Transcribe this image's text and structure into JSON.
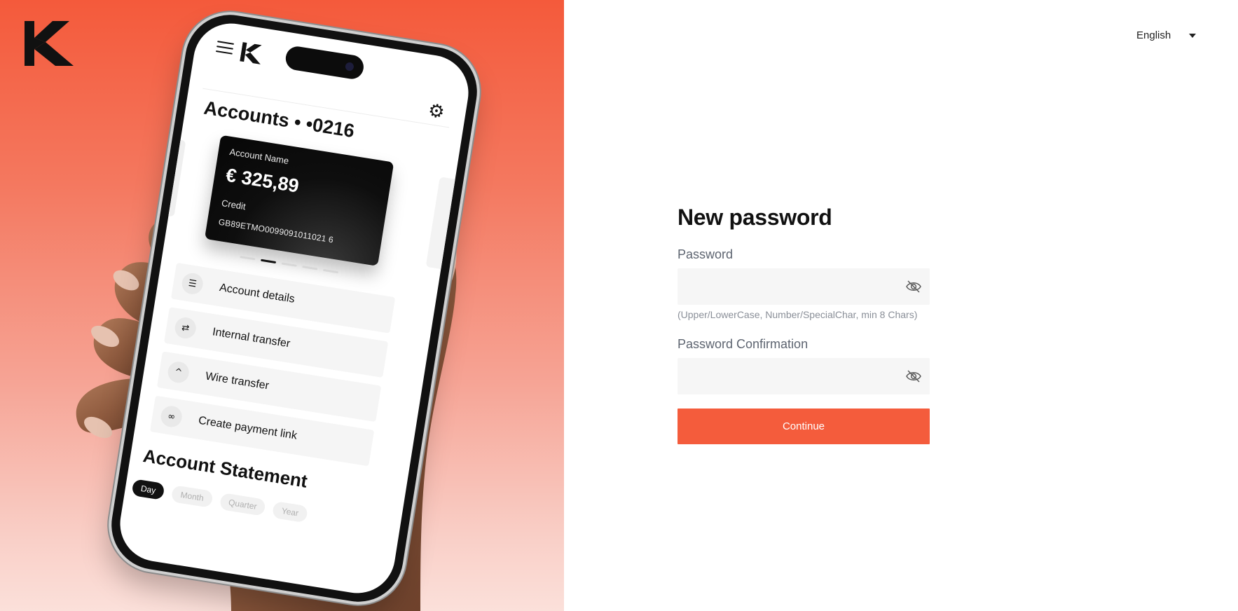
{
  "brand": {
    "logo_icon": "k-logo-icon",
    "accent_color": "#f45c3c"
  },
  "language": {
    "selected": "English",
    "icon": "chevron-down-icon"
  },
  "phone": {
    "menu_icon": "hamburger-menu-icon",
    "settings_icon": "gear-icon",
    "title": "Accounts • •0216",
    "card": {
      "name": "Account Name",
      "amount": "€ 325,89",
      "type": "Credit",
      "iban": "GB89ETMO0099091011021 6"
    },
    "actions": [
      {
        "label": "Account details",
        "icon": "list-icon"
      },
      {
        "label": "Internal transfer",
        "icon": "transfer-arrows-icon"
      },
      {
        "label": "Wire transfer",
        "icon": "caret-up-icon"
      },
      {
        "label": "Create payment link",
        "icon": "link-icon"
      }
    ],
    "statement_title": "Account Statement",
    "periods": [
      "Day",
      "Month",
      "Quarter",
      "Year"
    ]
  },
  "form": {
    "title": "New password",
    "password": {
      "label": "Password",
      "value": "",
      "hint": "(Upper/LowerCase, Number/SpecialChar, min 8 Chars)",
      "icon": "eye-slash-icon"
    },
    "confirmation": {
      "label": "Password Confirmation",
      "value": "",
      "icon": "eye-slash-icon"
    },
    "submit_label": "Continue"
  }
}
